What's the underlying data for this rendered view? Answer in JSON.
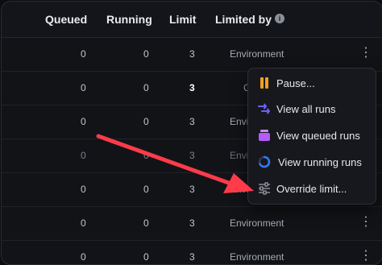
{
  "header": {
    "queued": "Queued",
    "running": "Running",
    "limit": "Limit",
    "limited_by": "Limited by",
    "info_icon": "i"
  },
  "rows": [
    {
      "queued": "0",
      "running": "0",
      "limit": "3",
      "limited_by": "Environment"
    },
    {
      "queued": "0",
      "running": "0",
      "limit": "3",
      "limited_by": "C"
    },
    {
      "queued": "0",
      "running": "0",
      "limit": "3",
      "limited_by": "Envi"
    },
    {
      "queued": "0",
      "running": "0",
      "limit": "3",
      "limited_by": "Envi"
    },
    {
      "queued": "0",
      "running": "0",
      "limit": "3",
      "limited_by": "Envi"
    },
    {
      "queued": "0",
      "running": "0",
      "limit": "3",
      "limited_by": "Environment"
    },
    {
      "queued": "0",
      "running": "0",
      "limit": "3",
      "limited_by": "Environment"
    }
  ],
  "kebab_glyph": "⋮",
  "menu": {
    "items": [
      {
        "label": "Pause...",
        "icon": "pause-icon"
      },
      {
        "label": "View all runs",
        "icon": "runs-icon"
      },
      {
        "label": "View queued runs",
        "icon": "queue-icon"
      },
      {
        "label": "View running runs",
        "icon": "spinner-icon"
      },
      {
        "label": "Override limit...",
        "icon": "sliders-icon"
      }
    ]
  },
  "colors": {
    "pause": "#f0a020",
    "runs": "#6b63f6",
    "queue": "#b45cf5",
    "spinner": "#2f7cf6",
    "annotation_arrow": "#ff3b4a"
  }
}
